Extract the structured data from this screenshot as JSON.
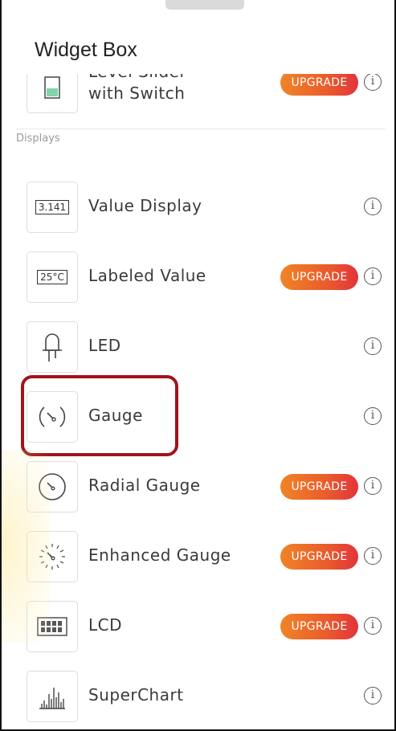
{
  "header": {
    "title": "Widget Box"
  },
  "partial_item": {
    "label_line1": "Level Slider",
    "label_line2": "with Switch",
    "upgrade_label": "UPGRADE"
  },
  "section": {
    "label": "Displays"
  },
  "items": [
    {
      "label": "Value Display",
      "icon": "value-display-icon",
      "icon_text": "3.141",
      "upgrade": false
    },
    {
      "label": "Labeled Value",
      "icon": "labeled-value-icon",
      "icon_text": "25°C",
      "upgrade": true,
      "upgrade_label": "UPGRADE"
    },
    {
      "label": "LED",
      "icon": "led-icon",
      "upgrade": false
    },
    {
      "label": "Gauge",
      "icon": "gauge-icon",
      "upgrade": false,
      "highlighted": true
    },
    {
      "label": "Radial Gauge",
      "icon": "radial-gauge-icon",
      "upgrade": true,
      "upgrade_label": "UPGRADE"
    },
    {
      "label": "Enhanced Gauge",
      "icon": "enhanced-gauge-icon",
      "upgrade": true,
      "upgrade_label": "UPGRADE"
    },
    {
      "label": "LCD",
      "icon": "lcd-icon",
      "upgrade": true,
      "upgrade_label": "UPGRADE"
    },
    {
      "label": "SuperChart",
      "icon": "superchart-icon",
      "upgrade": false
    }
  ],
  "info_glyph": "i",
  "colors": {
    "upgrade_start": "#ef8427",
    "upgrade_end": "#e3333c",
    "highlight_border": "#a0141c",
    "led_green": "#7fd4a8"
  }
}
